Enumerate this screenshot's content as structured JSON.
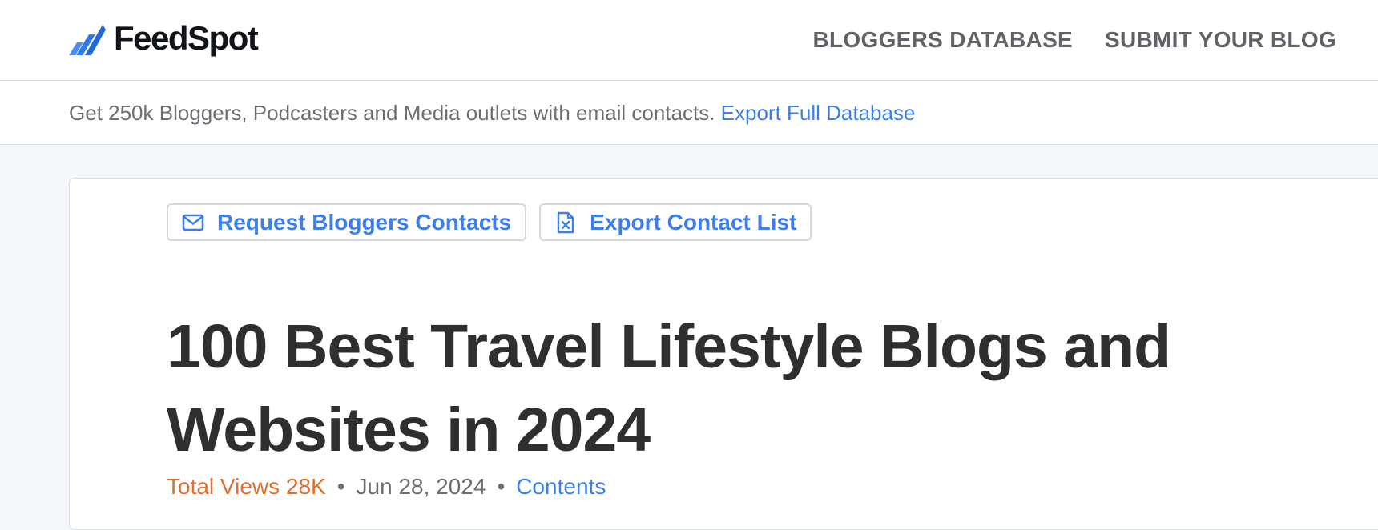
{
  "header": {
    "brand": "FeedSpot",
    "nav": [
      {
        "label": "BLOGGERS DATABASE"
      },
      {
        "label": "SUBMIT YOUR BLOG"
      }
    ]
  },
  "promo": {
    "text": "Get 250k Bloggers, Podcasters and Media outlets with email contacts.",
    "link_label": "Export Full Database"
  },
  "actions": [
    {
      "label": "Request Bloggers Contacts",
      "icon": "envelope-icon"
    },
    {
      "label": "Export Contact List",
      "icon": "excel-file-icon"
    }
  ],
  "article": {
    "title": "100 Best Travel Lifestyle Blogs and Websites in 2024",
    "views": "Total Views 28K",
    "separator": "•",
    "date": "Jun 28, 2024",
    "contents_link": "Contents"
  },
  "colors": {
    "accent_blue": "#3d7fe6",
    "views_orange": "#e0702d",
    "title_text": "#2e2f31",
    "muted_text": "#6b6f75",
    "page_bg": "#f4f7fc"
  }
}
